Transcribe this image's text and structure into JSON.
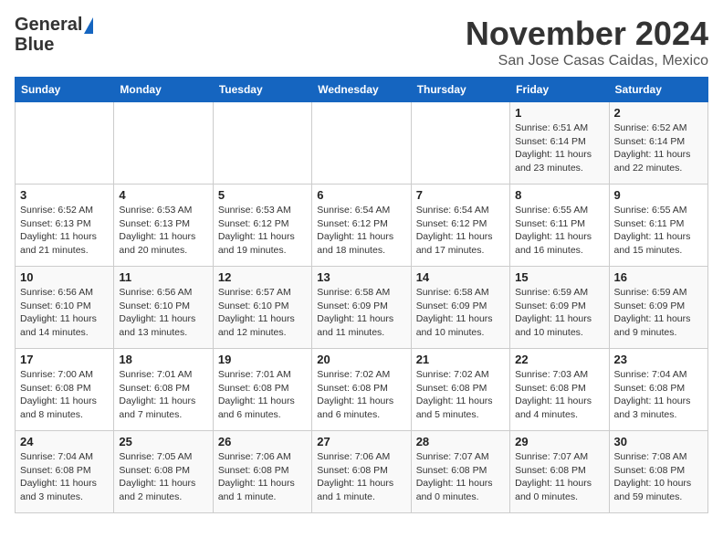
{
  "header": {
    "logo_line1": "General",
    "logo_line2": "Blue",
    "month": "November 2024",
    "location": "San Jose Casas Caidas, Mexico"
  },
  "days_of_week": [
    "Sunday",
    "Monday",
    "Tuesday",
    "Wednesday",
    "Thursday",
    "Friday",
    "Saturday"
  ],
  "weeks": [
    [
      {
        "day": "",
        "info": ""
      },
      {
        "day": "",
        "info": ""
      },
      {
        "day": "",
        "info": ""
      },
      {
        "day": "",
        "info": ""
      },
      {
        "day": "",
        "info": ""
      },
      {
        "day": "1",
        "info": "Sunrise: 6:51 AM\nSunset: 6:14 PM\nDaylight: 11 hours\nand 23 minutes."
      },
      {
        "day": "2",
        "info": "Sunrise: 6:52 AM\nSunset: 6:14 PM\nDaylight: 11 hours\nand 22 minutes."
      }
    ],
    [
      {
        "day": "3",
        "info": "Sunrise: 6:52 AM\nSunset: 6:13 PM\nDaylight: 11 hours\nand 21 minutes."
      },
      {
        "day": "4",
        "info": "Sunrise: 6:53 AM\nSunset: 6:13 PM\nDaylight: 11 hours\nand 20 minutes."
      },
      {
        "day": "5",
        "info": "Sunrise: 6:53 AM\nSunset: 6:12 PM\nDaylight: 11 hours\nand 19 minutes."
      },
      {
        "day": "6",
        "info": "Sunrise: 6:54 AM\nSunset: 6:12 PM\nDaylight: 11 hours\nand 18 minutes."
      },
      {
        "day": "7",
        "info": "Sunrise: 6:54 AM\nSunset: 6:12 PM\nDaylight: 11 hours\nand 17 minutes."
      },
      {
        "day": "8",
        "info": "Sunrise: 6:55 AM\nSunset: 6:11 PM\nDaylight: 11 hours\nand 16 minutes."
      },
      {
        "day": "9",
        "info": "Sunrise: 6:55 AM\nSunset: 6:11 PM\nDaylight: 11 hours\nand 15 minutes."
      }
    ],
    [
      {
        "day": "10",
        "info": "Sunrise: 6:56 AM\nSunset: 6:10 PM\nDaylight: 11 hours\nand 14 minutes."
      },
      {
        "day": "11",
        "info": "Sunrise: 6:56 AM\nSunset: 6:10 PM\nDaylight: 11 hours\nand 13 minutes."
      },
      {
        "day": "12",
        "info": "Sunrise: 6:57 AM\nSunset: 6:10 PM\nDaylight: 11 hours\nand 12 minutes."
      },
      {
        "day": "13",
        "info": "Sunrise: 6:58 AM\nSunset: 6:09 PM\nDaylight: 11 hours\nand 11 minutes."
      },
      {
        "day": "14",
        "info": "Sunrise: 6:58 AM\nSunset: 6:09 PM\nDaylight: 11 hours\nand 10 minutes."
      },
      {
        "day": "15",
        "info": "Sunrise: 6:59 AM\nSunset: 6:09 PM\nDaylight: 11 hours\nand 10 minutes."
      },
      {
        "day": "16",
        "info": "Sunrise: 6:59 AM\nSunset: 6:09 PM\nDaylight: 11 hours\nand 9 minutes."
      }
    ],
    [
      {
        "day": "17",
        "info": "Sunrise: 7:00 AM\nSunset: 6:08 PM\nDaylight: 11 hours\nand 8 minutes."
      },
      {
        "day": "18",
        "info": "Sunrise: 7:01 AM\nSunset: 6:08 PM\nDaylight: 11 hours\nand 7 minutes."
      },
      {
        "day": "19",
        "info": "Sunrise: 7:01 AM\nSunset: 6:08 PM\nDaylight: 11 hours\nand 6 minutes."
      },
      {
        "day": "20",
        "info": "Sunrise: 7:02 AM\nSunset: 6:08 PM\nDaylight: 11 hours\nand 6 minutes."
      },
      {
        "day": "21",
        "info": "Sunrise: 7:02 AM\nSunset: 6:08 PM\nDaylight: 11 hours\nand 5 minutes."
      },
      {
        "day": "22",
        "info": "Sunrise: 7:03 AM\nSunset: 6:08 PM\nDaylight: 11 hours\nand 4 minutes."
      },
      {
        "day": "23",
        "info": "Sunrise: 7:04 AM\nSunset: 6:08 PM\nDaylight: 11 hours\nand 3 minutes."
      }
    ],
    [
      {
        "day": "24",
        "info": "Sunrise: 7:04 AM\nSunset: 6:08 PM\nDaylight: 11 hours\nand 3 minutes."
      },
      {
        "day": "25",
        "info": "Sunrise: 7:05 AM\nSunset: 6:08 PM\nDaylight: 11 hours\nand 2 minutes."
      },
      {
        "day": "26",
        "info": "Sunrise: 7:06 AM\nSunset: 6:08 PM\nDaylight: 11 hours\nand 1 minute."
      },
      {
        "day": "27",
        "info": "Sunrise: 7:06 AM\nSunset: 6:08 PM\nDaylight: 11 hours\nand 1 minute."
      },
      {
        "day": "28",
        "info": "Sunrise: 7:07 AM\nSunset: 6:08 PM\nDaylight: 11 hours\nand 0 minutes."
      },
      {
        "day": "29",
        "info": "Sunrise: 7:07 AM\nSunset: 6:08 PM\nDaylight: 11 hours\nand 0 minutes."
      },
      {
        "day": "30",
        "info": "Sunrise: 7:08 AM\nSunset: 6:08 PM\nDaylight: 10 hours\nand 59 minutes."
      }
    ]
  ]
}
